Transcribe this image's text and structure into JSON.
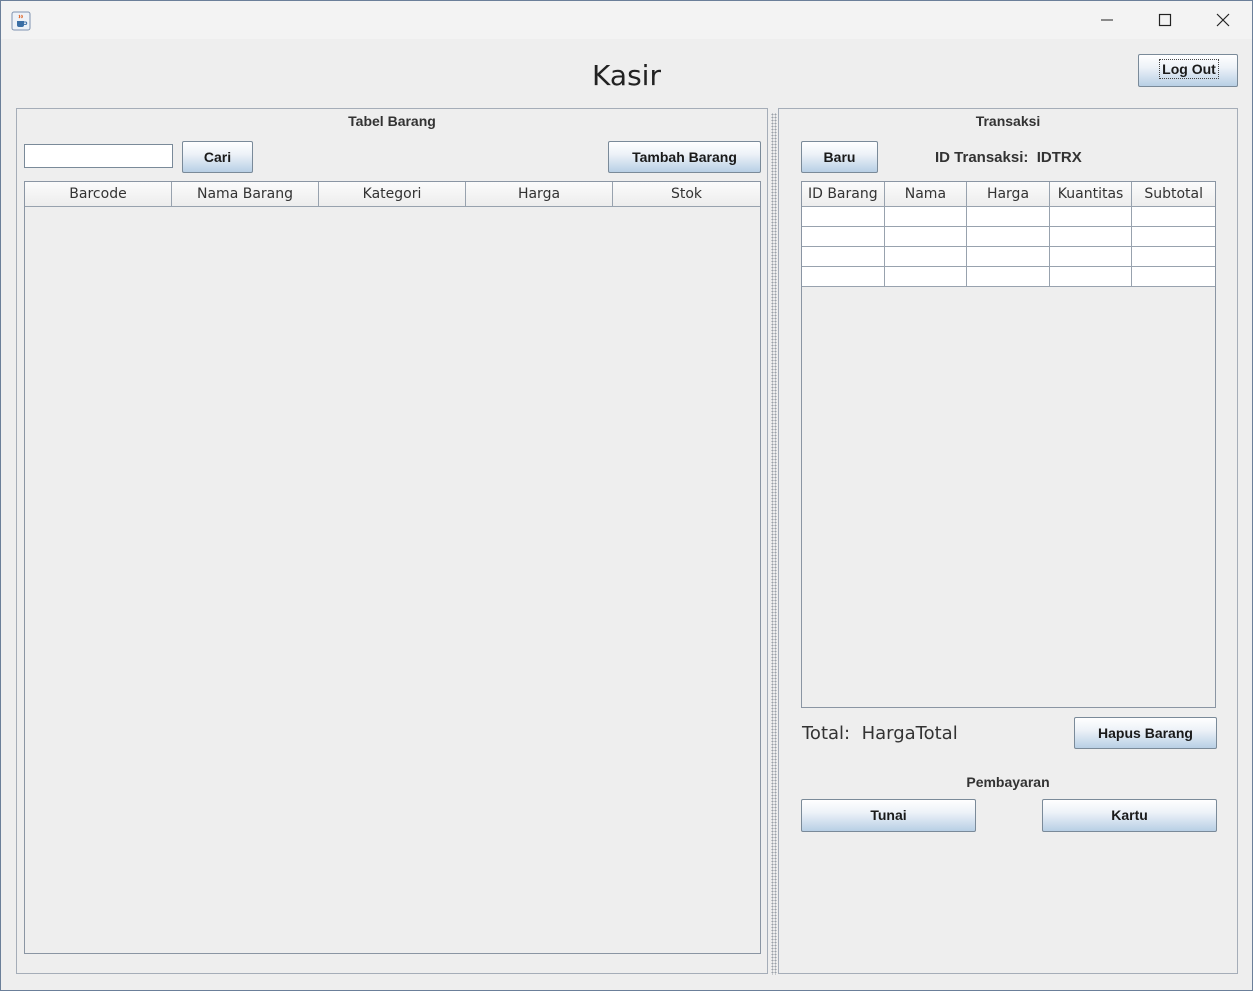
{
  "window": {
    "title_icon": "java-coffee-icon",
    "controls": [
      "minimize-icon",
      "maximize-icon",
      "close-icon"
    ]
  },
  "header": {
    "title": "Kasir",
    "logout_label": "Log Out"
  },
  "left_panel": {
    "title": "Tabel Barang",
    "search_placeholder": "",
    "search_value": "",
    "search_button": "Cari",
    "add_button": "Tambah Barang",
    "table": {
      "columns": [
        "Barcode",
        "Nama Barang",
        "Kategori",
        "Harga",
        "Stok"
      ],
      "rows": []
    }
  },
  "right_panel": {
    "title": "Transaksi",
    "new_button": "Baru",
    "transaction_id_label": "ID Transaksi:",
    "transaction_id_value": "IDTRX",
    "table": {
      "columns": [
        "ID Barang",
        "Nama",
        "Harga",
        "Kuantitas",
        "Subtotal"
      ],
      "rows": [
        [
          "",
          "",
          "",
          "",
          ""
        ],
        [
          "",
          "",
          "",
          "",
          ""
        ],
        [
          "",
          "",
          "",
          "",
          ""
        ],
        [
          "",
          "",
          "",
          "",
          ""
        ]
      ]
    },
    "total_label": "Total:",
    "total_value": "HargaTotal",
    "delete_button": "Hapus Barang",
    "payment_title": "Pembayaran",
    "cash_button": "Tunai",
    "card_button": "Kartu"
  }
}
